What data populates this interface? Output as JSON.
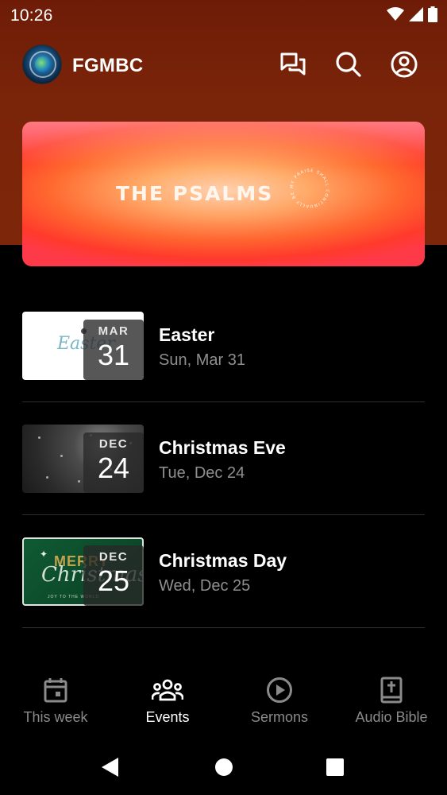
{
  "status_bar": {
    "time": "10:26"
  },
  "app_bar": {
    "title": "FGMBC",
    "icons": [
      "chat-icon",
      "search-icon",
      "account-icon"
    ]
  },
  "banner": {
    "title": "THE PSALMS",
    "seal_text": "MY PRAISE SHALL CONTINUALLY BE IN MY MOUTH"
  },
  "events": [
    {
      "title": "Easter",
      "date": "Sun, Mar 31",
      "month": "MAR",
      "day": "31",
      "thumb_text": "Easter"
    },
    {
      "title": "Christmas Eve",
      "date": "Tue, Dec 24",
      "month": "DEC",
      "day": "24"
    },
    {
      "title": "Christmas Day",
      "date": "Wed, Dec 25",
      "month": "DEC",
      "day": "25",
      "thumb_text_1": "MERRY",
      "thumb_text_2": "Christmas",
      "thumb_text_3": "JOY TO THE WORLD"
    }
  ],
  "bottom_nav": {
    "items": [
      {
        "label": "This week",
        "icon": "calendar-icon"
      },
      {
        "label": "Events",
        "icon": "people-icon",
        "active": true
      },
      {
        "label": "Sermons",
        "icon": "play-circle-icon"
      },
      {
        "label": "Audio Bible",
        "icon": "bible-icon"
      }
    ]
  },
  "colors": {
    "header_bg": "#7a2409",
    "background": "#000000",
    "muted_text": "#8f8f8f",
    "active_nav": "#ffffff"
  }
}
